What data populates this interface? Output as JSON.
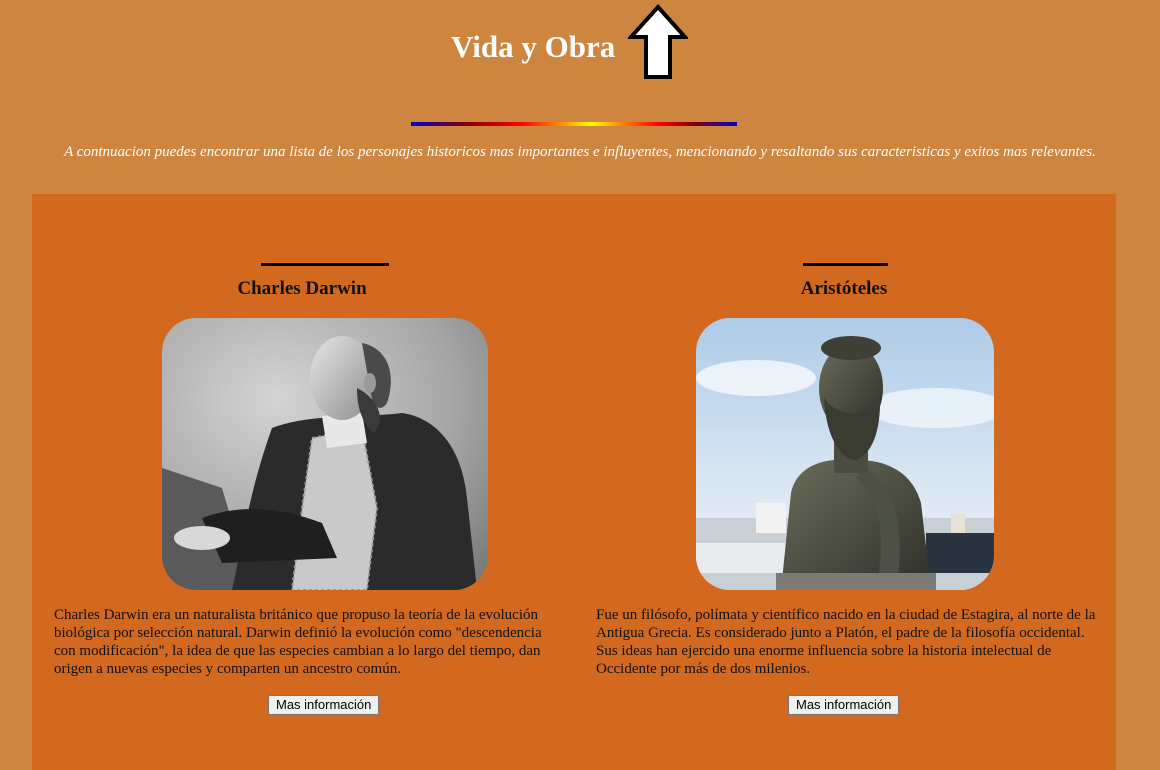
{
  "header": {
    "title": "Vida y Obra",
    "arrow_icon": "up-arrow-icon"
  },
  "intro": {
    "text": "A contnuacion puedes encontrar una lista de los personajes historicos mas importantes e influyentes, mencionando y resaltando sus caracteristicas y exitos mas relevantes."
  },
  "colors": {
    "page_background": "#CD853F",
    "panel_background": "#D2691E",
    "title_color": "#FFFFFF"
  },
  "people": [
    {
      "name": "Charles Darwin",
      "description": "Charles Darwin era un naturalista británico que propuso la teoría de la evolución biológica por selección natural. Darwin definió la evolución como \"descendencia con modificación\", la idea de que las especies cambian a lo largo del tiempo, dan origen a nuevas especies y comparten un ancestro común.",
      "button_label": "Mas información"
    },
    {
      "name": "Aristóteles",
      "description": "Fue un filósofo, polímata y científico nacido en la ciudad de Estagira, al norte de la Antigua Grecia. Es considerado junto a Platón, el padre de la filosofía occidental. Sus ideas han ejercido una enorme influencia sobre la historia intelectual de Occidente por más de dos milenios.",
      "button_label": "Mas información"
    }
  ]
}
